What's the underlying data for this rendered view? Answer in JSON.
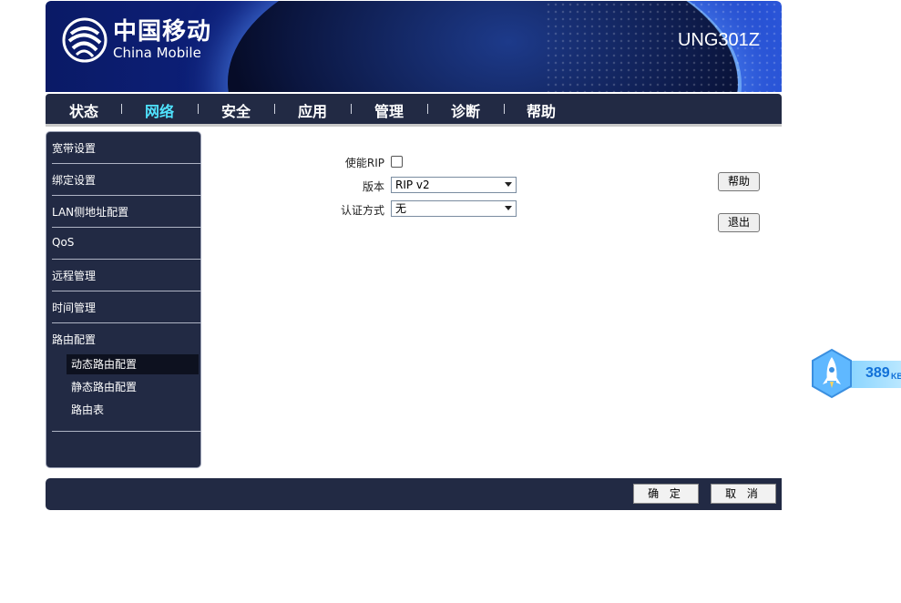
{
  "header": {
    "logo_cn": "中国移动",
    "logo_en": "China Mobile",
    "model": "UNG301Z"
  },
  "nav": {
    "items": [
      {
        "label": "状态"
      },
      {
        "label": "网络",
        "active": true
      },
      {
        "label": "安全"
      },
      {
        "label": "应用"
      },
      {
        "label": "管理"
      },
      {
        "label": "诊断"
      },
      {
        "label": "帮助"
      }
    ],
    "separator": "|"
  },
  "sidebar": {
    "items": [
      {
        "label": "宽带设置"
      },
      {
        "label": "绑定设置"
      },
      {
        "label": "LAN侧地址配置"
      },
      {
        "label": "QoS"
      },
      {
        "label": "远程管理"
      },
      {
        "label": "时间管理"
      },
      {
        "label": "路由配置"
      }
    ],
    "sub_items": [
      {
        "label": "动态路由配置",
        "active": true
      },
      {
        "label": "静态路由配置"
      },
      {
        "label": "路由表"
      }
    ]
  },
  "form": {
    "enable_rip_label": "使能RIP",
    "enable_rip_checked": false,
    "version_label": "版本",
    "version_value": "RIP v2",
    "auth_label": "认证方式",
    "auth_value": "无"
  },
  "side_buttons": {
    "help": "帮助",
    "logout": "退出"
  },
  "footer": {
    "ok": "确 定",
    "cancel": "取 消"
  },
  "speed_widget": {
    "value": "389",
    "unit": "KB/"
  },
  "colors": {
    "nav_bg": "#222a44",
    "nav_active": "#4fe3ff",
    "header_blue": "#10258a"
  }
}
